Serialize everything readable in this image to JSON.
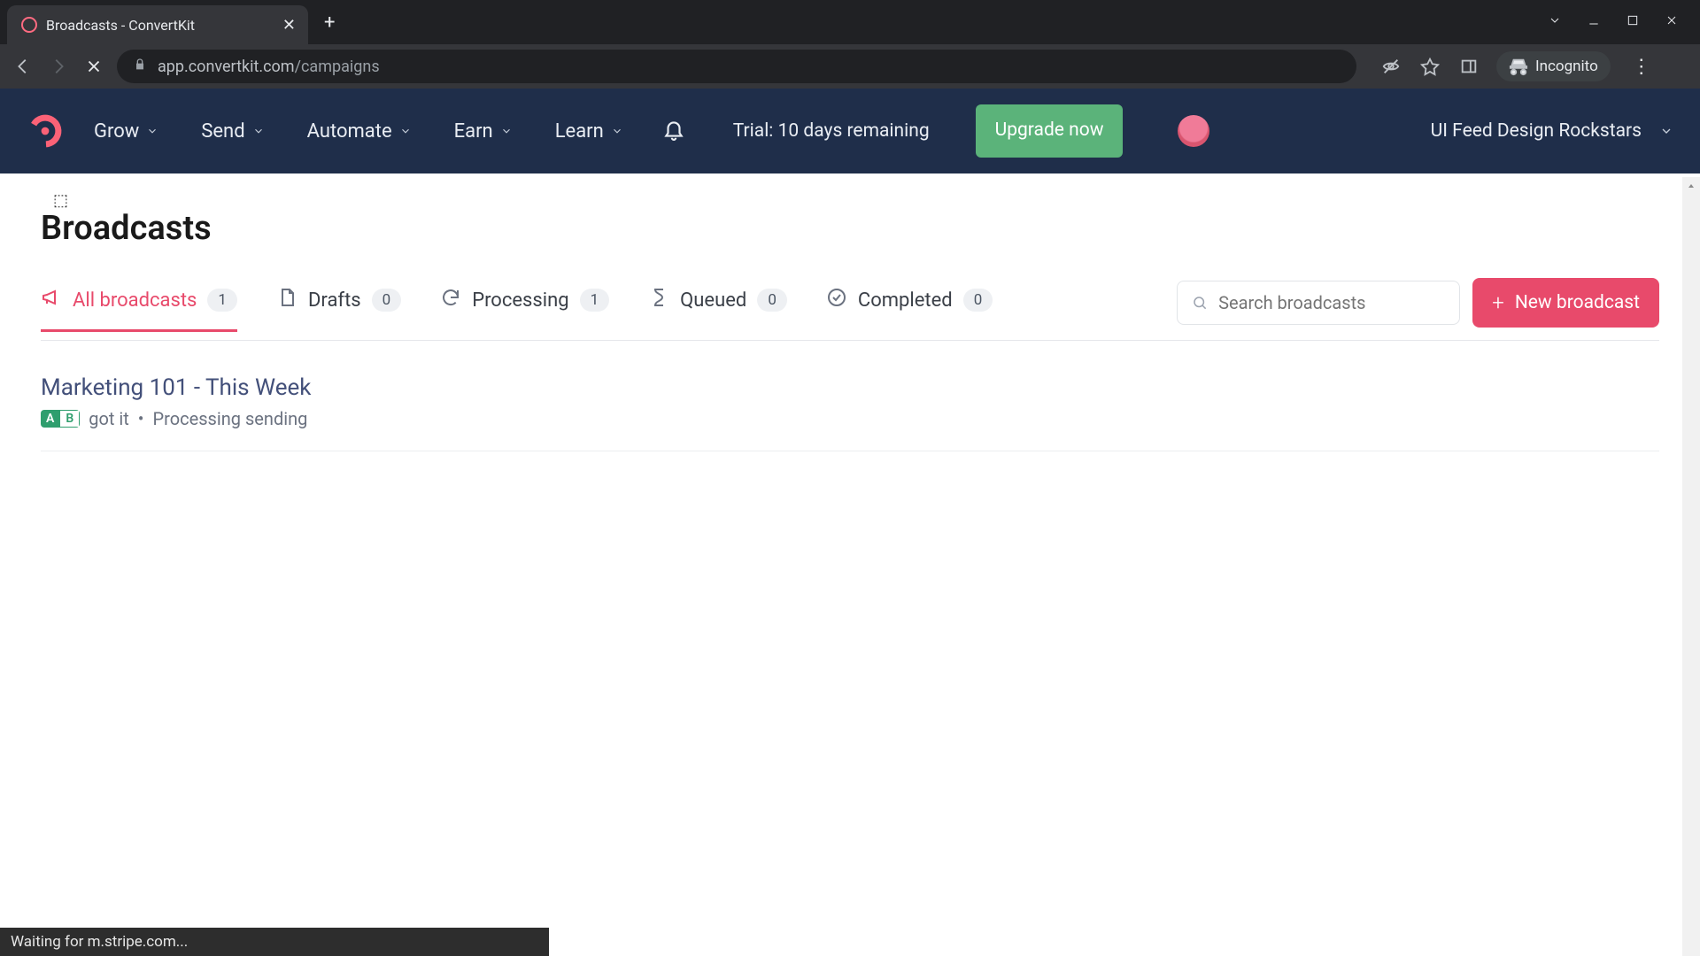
{
  "browser": {
    "tab_title": "Broadcasts - ConvertKit",
    "url_host": "app.convertkit.com",
    "url_path": "/campaigns",
    "incognito_label": "Incognito"
  },
  "header": {
    "nav": [
      "Grow",
      "Send",
      "Automate",
      "Earn",
      "Learn"
    ],
    "trial_text": "Trial: 10 days remaining",
    "upgrade_label": "Upgrade now",
    "account_name": "UI Feed Design Rockstars"
  },
  "page": {
    "title": "Broadcasts",
    "filters": [
      {
        "key": "all",
        "label": "All broadcasts",
        "count": "1",
        "icon": "megaphone",
        "active": true
      },
      {
        "key": "drafts",
        "label": "Drafts",
        "count": "0",
        "icon": "file",
        "active": false
      },
      {
        "key": "processing",
        "label": "Processing",
        "count": "1",
        "icon": "refresh",
        "active": false
      },
      {
        "key": "queued",
        "label": "Queued",
        "count": "0",
        "icon": "hourglass",
        "active": false
      },
      {
        "key": "completed",
        "label": "Completed",
        "count": "0",
        "icon": "check-circle",
        "active": false
      }
    ],
    "search_placeholder": "Search broadcasts",
    "new_button": "New broadcast",
    "rows": [
      {
        "title": "Marketing 101 - This Week",
        "ab": {
          "a": "A",
          "b": "B"
        },
        "subject": "got it",
        "sep": "•",
        "status": "Processing sending"
      }
    ]
  },
  "status_bar": "Waiting for m.stripe.com..."
}
